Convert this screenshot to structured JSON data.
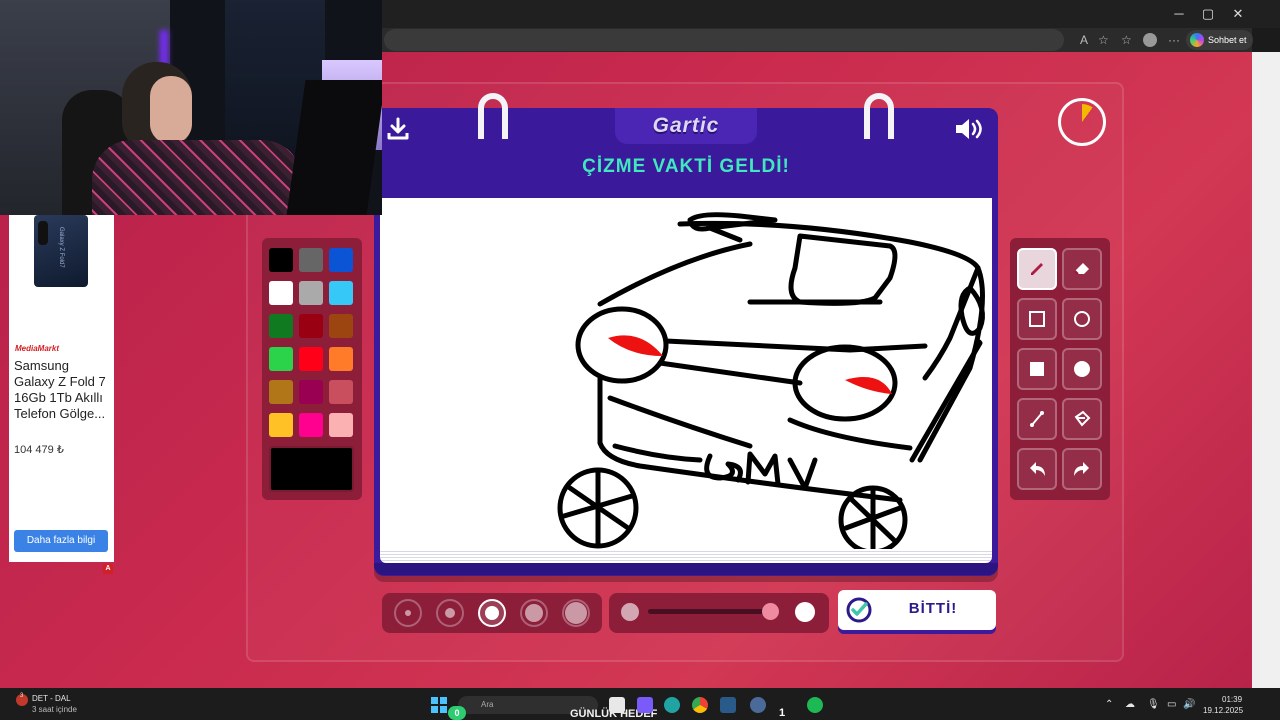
{
  "browser": {
    "chat_button_label": "Sohbet et",
    "window_controls": [
      "minimize-icon",
      "maximize-icon",
      "close-icon"
    ]
  },
  "ad": {
    "phone_text": "Galaxy Z Fold7",
    "brand": "MediaMarkt",
    "title": "Samsung Galaxy Z Fold 7 16Gb 1Tb Akıllı Telefon Gölge...",
    "price": "104 479 ₺",
    "button_label": "Daha fazla bilgi",
    "flag": "A"
  },
  "game": {
    "logo": "Gartic",
    "header_title": "ÇİZME VAKTİ GELDİ!",
    "canvas_text": "BMV",
    "done_label": "BİTTİ!",
    "timer_elapsed_fraction": 0.1,
    "colors": {
      "accent_title": "#41e7bf",
      "card": "#3b1a9c",
      "panel": "#8c1e3a",
      "page_bg": "#c92a4e",
      "timer": "#f5b800"
    },
    "palette": [
      "#000000",
      "#666666",
      "#0b54d6",
      "#ffffff",
      "#aaaaaa",
      "#36c9f7",
      "#0f7a1f",
      "#990012",
      "#9c4510",
      "#2bd34a",
      "#ff0019",
      "#ff7a29",
      "#b07617",
      "#990052",
      "#c94e5e",
      "#ffc125",
      "#ff008f",
      "#fbb1b1"
    ],
    "selected_color": "#000000",
    "tools": [
      {
        "name": "pencil-tool",
        "icon": "pencil-icon",
        "active": true
      },
      {
        "name": "eraser-tool",
        "icon": "eraser-icon",
        "active": false
      },
      {
        "name": "rectangle-outline-tool",
        "icon": "square-outline-icon",
        "active": false
      },
      {
        "name": "ellipse-outline-tool",
        "icon": "circle-outline-icon",
        "active": false
      },
      {
        "name": "rectangle-fill-tool",
        "icon": "square-filled-icon",
        "active": false
      },
      {
        "name": "ellipse-fill-tool",
        "icon": "circle-filled-icon",
        "active": false
      },
      {
        "name": "line-tool",
        "icon": "line-icon",
        "active": false
      },
      {
        "name": "fill-bucket-tool",
        "icon": "bucket-icon",
        "active": false
      },
      {
        "name": "undo-tool",
        "icon": "undo-icon",
        "active": false
      },
      {
        "name": "redo-tool",
        "icon": "redo-icon",
        "active": false
      }
    ],
    "brush_sizes": [
      1,
      2,
      3,
      4,
      5
    ],
    "selected_brush_size": 3,
    "opacity_value": 0.95
  },
  "taskbar": {
    "weather_title": "DET - DAL",
    "weather_subtitle": "3 saat içinde",
    "weather_badge": "3",
    "search_placeholder": "Ara",
    "goal_label": "GÜNLÜK HEDEF",
    "goal_progress": "0",
    "goal_count": "1",
    "time": "01:39",
    "date": "19.12.2025"
  }
}
